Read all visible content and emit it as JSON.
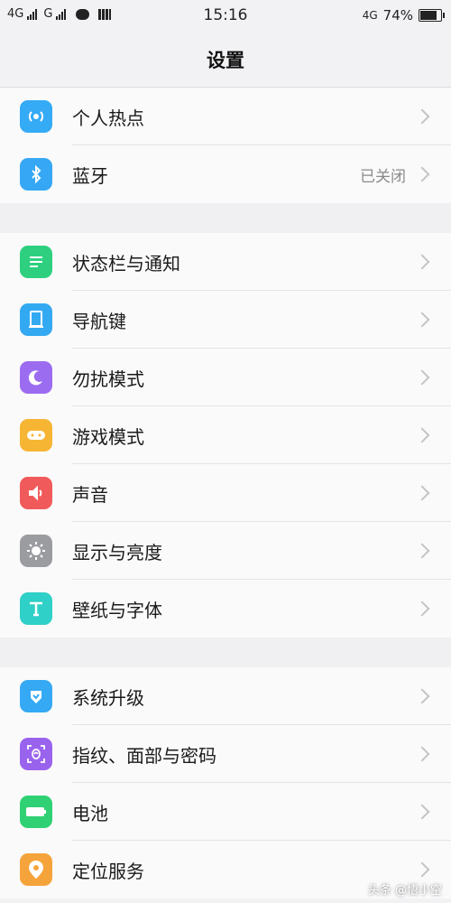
{
  "status_bar": {
    "network1": "4G",
    "network2": "G",
    "time": "15:16",
    "right_network": "4G",
    "battery": "74%"
  },
  "header": {
    "title": "设置"
  },
  "groups": [
    {
      "items": [
        {
          "label": "个人热点",
          "icon": "hotspot-icon",
          "color": "#35aaf5",
          "value": ""
        },
        {
          "label": "蓝牙",
          "icon": "bluetooth-icon",
          "color": "#36a7f4",
          "value": "已关闭"
        }
      ]
    },
    {
      "items": [
        {
          "label": "状态栏与通知",
          "icon": "notification-icon",
          "color": "#2ed07f",
          "value": ""
        },
        {
          "label": "导航键",
          "icon": "navigation-icon",
          "color": "#33a9f2",
          "value": ""
        },
        {
          "label": "勿扰模式",
          "icon": "moon-icon",
          "color": "#9b6cf0",
          "value": ""
        },
        {
          "label": "游戏模式",
          "icon": "gamepad-icon",
          "color": "#f7b534",
          "value": ""
        },
        {
          "label": "声音",
          "icon": "speaker-icon",
          "color": "#f15a5a",
          "value": ""
        },
        {
          "label": "显示与亮度",
          "icon": "brightness-icon",
          "color": "#9b9ca0",
          "value": ""
        },
        {
          "label": "壁纸与字体",
          "icon": "font-icon",
          "color": "#2fd0c7",
          "value": ""
        }
      ]
    },
    {
      "items": [
        {
          "label": "系统升级",
          "icon": "update-icon",
          "color": "#35a9f4",
          "value": ""
        },
        {
          "label": "指纹、面部与密码",
          "icon": "fingerprint-icon",
          "color": "#9a63ee",
          "value": ""
        },
        {
          "label": "电池",
          "icon": "battery-icon",
          "color": "#2fd174",
          "value": ""
        },
        {
          "label": "定位服务",
          "icon": "location-icon",
          "color": "#f5a43c",
          "value": ""
        }
      ]
    }
  ],
  "watermark": "头条 @悟小空"
}
